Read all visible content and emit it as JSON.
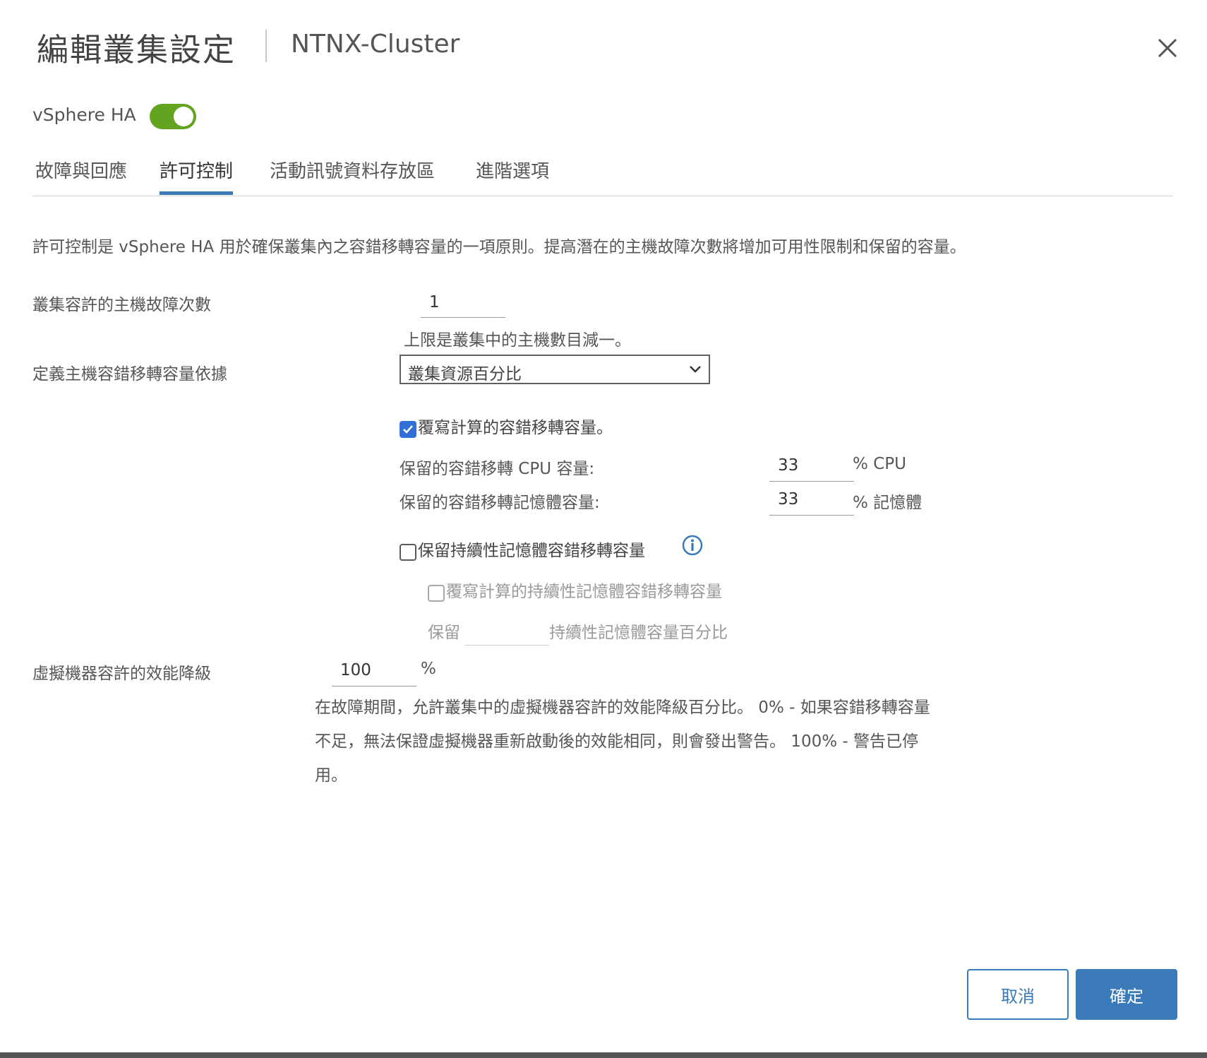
{
  "dialog": {
    "title": "編輯叢集設定",
    "subtitle": "NTNX-Cluster"
  },
  "ha": {
    "label": "vSphere HA",
    "enabled": true,
    "toggle_color": "#62a420"
  },
  "tabs": [
    {
      "label": "故障與回應",
      "active": false
    },
    {
      "label": "許可控制",
      "active": true
    },
    {
      "label": "活動訊號資料存放區",
      "active": false
    },
    {
      "label": "進階選項",
      "active": false
    }
  ],
  "description": "許可控制是 vSphere HA 用於確保叢集內之容錯移轉容量的一項原則。提高潛在的主機故障次數將增加可用性限制和保留的容量。",
  "host_failures": {
    "label": "叢集容許的主機故障次數",
    "value": "1",
    "help": "上限是叢集中的主機數目減一。"
  },
  "failover_capacity": {
    "label": "定義主機容錯移轉容量依據",
    "selected": "叢集資源百分比"
  },
  "override": {
    "label": "覆寫計算的容錯移轉容量。",
    "checked": true,
    "cpu_label": "保留的容錯移轉 CPU 容量:",
    "cpu_value": "33",
    "cpu_unit": "% CPU",
    "mem_label": "保留的容錯移轉記憶體容量:",
    "mem_value": "33",
    "mem_unit": "% 記憶體"
  },
  "pmem": {
    "label": "保留持續性記憶體容錯移轉容量",
    "checked": false,
    "override_label": "覆寫計算的持續性記憶體容錯移轉容量",
    "override_checked": false,
    "reserve_prefix": "保留",
    "reserve_value": "",
    "reserve_suffix": "持續性記憶體容量百分比"
  },
  "vm_degradation": {
    "label": "虛擬機器容許的效能降級",
    "value": "100",
    "unit": "%",
    "help_line1": "在故障期間，允許叢集中的虛擬機器容許的效能降級百分比。 0% - 如果容錯移轉容量",
    "help_line2": "不足，無法保證虛擬機器重新啟動後的效能相同，則會發出警告。 100% - 警告已停",
    "help_line3": "用。"
  },
  "buttons": {
    "cancel": "取消",
    "ok": "確定"
  },
  "colors": {
    "accent": "#3a7ab8",
    "checkbox_checked": "#2f6fd6"
  }
}
